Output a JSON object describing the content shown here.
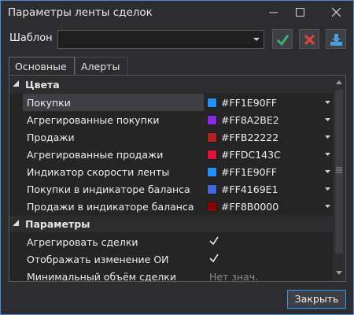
{
  "window": {
    "title": "Параметры ленты сделок"
  },
  "template": {
    "label": "Шаблон",
    "value": ""
  },
  "tabs": [
    {
      "label": "Основные",
      "active": true
    },
    {
      "label": "Алерты",
      "active": false
    }
  ],
  "categories": {
    "colors": "Цвета",
    "params": "Параметры"
  },
  "color_rows": [
    {
      "name": "Покупки",
      "value": "#FF1E90FF",
      "swatch": "#1e90ff",
      "selected": true
    },
    {
      "name": "Агрегированные покупки",
      "value": "#FF8A2BE2",
      "swatch": "#8a2be2",
      "selected": false
    },
    {
      "name": "Продажи",
      "value": "#FFB22222",
      "swatch": "#b22222",
      "selected": false
    },
    {
      "name": "Агрегированные продажи",
      "value": "#FFDC143C",
      "swatch": "#dc143c",
      "selected": false
    },
    {
      "name": "Индикатор скорости ленты",
      "value": "#FF1E90FF",
      "swatch": "#1e90ff",
      "selected": false
    },
    {
      "name": "Покупки в индикаторе баланса",
      "value": "#FF4169E1",
      "swatch": "#4169e1",
      "selected": false
    },
    {
      "name": "Продажи в индикаторе баланса",
      "value": "#FF8B0000",
      "swatch": "#8b0000",
      "selected": false
    }
  ],
  "param_rows": [
    {
      "name": "Агрегировать сделки",
      "checked": true
    },
    {
      "name": "Отображать изменение ОИ",
      "checked": true
    },
    {
      "name": "Минимальный объём сделки",
      "placeholder": "Нет знач."
    }
  ],
  "footer": {
    "close_label": "Закрыть"
  },
  "theme": {
    "accent": "#3794ff",
    "ok": "#3cb371",
    "cancel": "#e2463a",
    "save": "#4a9fe0"
  }
}
